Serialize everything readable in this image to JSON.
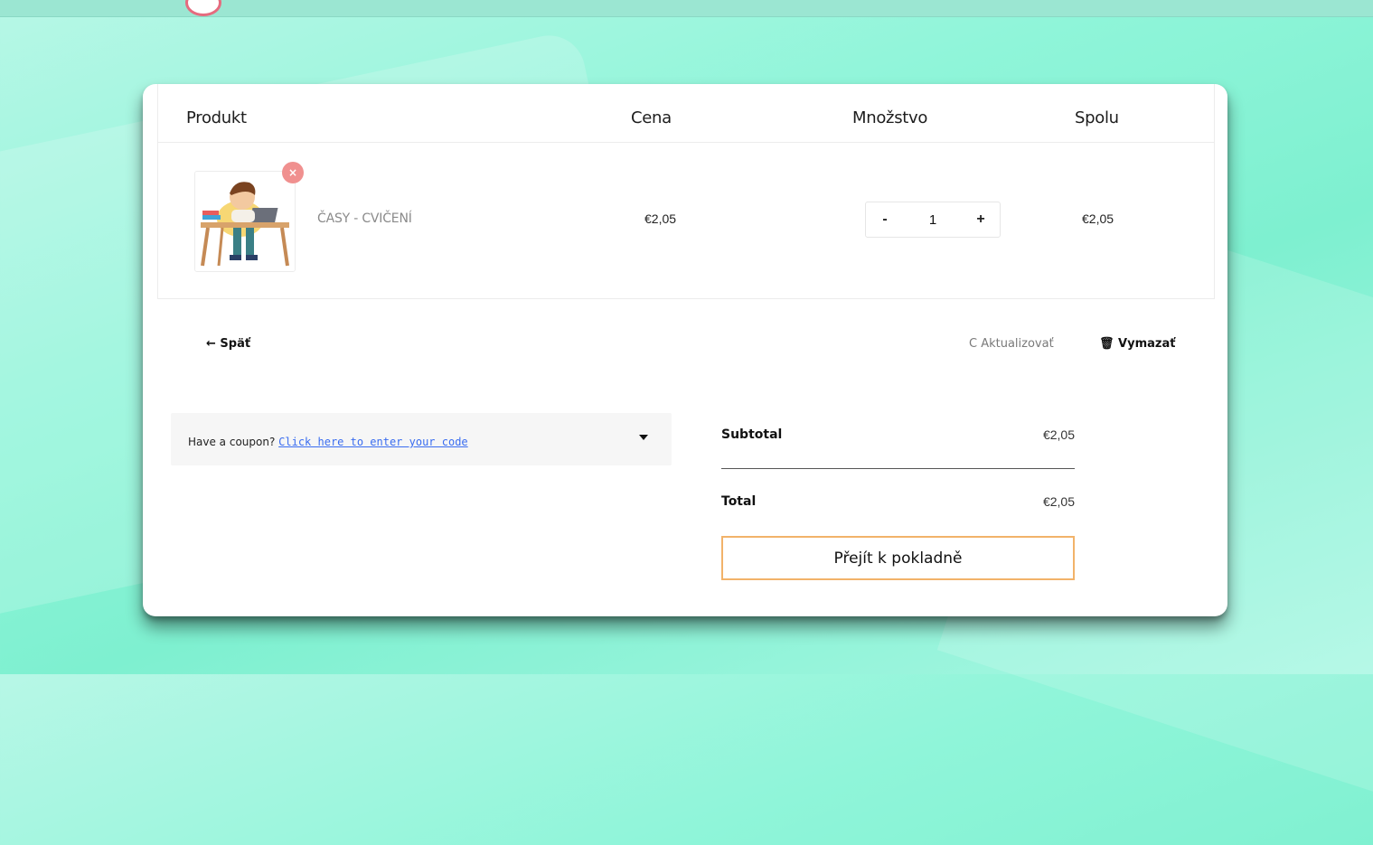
{
  "table": {
    "headers": {
      "product": "Produkt",
      "price": "Cena",
      "quantity": "Množstvo",
      "total": "Spolu"
    },
    "items": [
      {
        "name": "ČASY - CVIČENÍ",
        "price": "€2,05",
        "quantity": "1",
        "total": "€2,05",
        "remove_glyph": "×",
        "image_icon": "boy-at-desk-illustration"
      }
    ],
    "qty_minus": "-",
    "qty_plus": "+"
  },
  "actions": {
    "back_label": "← Späť",
    "update_label": "C Aktualizovať",
    "clear_label": "🗑 Vymazať"
  },
  "coupon": {
    "prompt": "Have a coupon? ",
    "link_text": "Click here to enter your code"
  },
  "totals": {
    "subtotal_label": "Subtotal",
    "subtotal_value": "€2,05",
    "total_label": "Total",
    "total_value": "€2,05",
    "checkout_label": "Přejít k pokladně"
  },
  "colors": {
    "background": "#8ff5d9",
    "remove_button": "#f0908f",
    "coupon_link": "#3a6df0",
    "checkout_border": "#f2b36a"
  }
}
